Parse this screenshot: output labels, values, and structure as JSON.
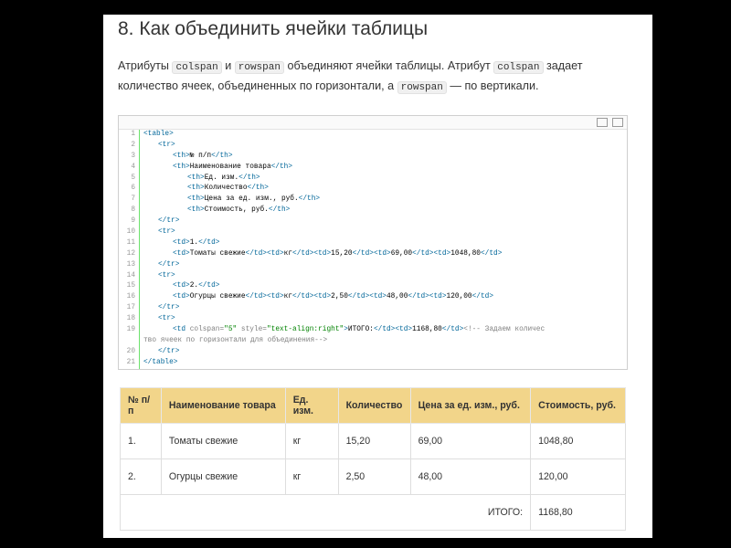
{
  "heading": "8. Как объединить ячейки таблицы",
  "intro": {
    "t1": "Атрибуты ",
    "c1": "colspan",
    "t2": " и ",
    "c2": "rowspan",
    "t3": " объединяют ячейки таблицы. Атрибут ",
    "c3": "colspan",
    "t4": " задает количество ячеек, объединенных по горизонтали, а ",
    "c4": "rowspan",
    "t5": " — по вертикали."
  },
  "code": {
    "toolbar_icons": [
      "copy-icon",
      "expand-icon"
    ],
    "lines": [
      {
        "n": "1",
        "i": 0,
        "parts": [
          [
            "tag",
            "<table>"
          ]
        ]
      },
      {
        "n": "2",
        "i": 1,
        "parts": [
          [
            "tag",
            "<tr>"
          ]
        ]
      },
      {
        "n": "3",
        "i": 2,
        "parts": [
          [
            "tag",
            "<th>"
          ],
          [
            "txt",
            "№ п/п"
          ],
          [
            "tag",
            "</th>"
          ]
        ]
      },
      {
        "n": "4",
        "i": 2,
        "parts": [
          [
            "tag",
            "<th>"
          ],
          [
            "txt",
            "Наименование товара"
          ],
          [
            "tag",
            "</th>"
          ]
        ]
      },
      {
        "n": "5",
        "i": 3,
        "parts": [
          [
            "tag",
            "<th>"
          ],
          [
            "txt",
            "Ед. изм."
          ],
          [
            "tag",
            "</th>"
          ]
        ]
      },
      {
        "n": "6",
        "i": 3,
        "parts": [
          [
            "tag",
            "<th>"
          ],
          [
            "txt",
            "Количество"
          ],
          [
            "tag",
            "</th>"
          ]
        ]
      },
      {
        "n": "7",
        "i": 3,
        "parts": [
          [
            "tag",
            "<th>"
          ],
          [
            "txt",
            "Цена за ед. изм., руб."
          ],
          [
            "tag",
            "</th>"
          ]
        ]
      },
      {
        "n": "8",
        "i": 3,
        "parts": [
          [
            "tag",
            "<th>"
          ],
          [
            "txt",
            "Стоимость, руб."
          ],
          [
            "tag",
            "</th>"
          ]
        ]
      },
      {
        "n": "9",
        "i": 1,
        "parts": [
          [
            "tag",
            "</tr>"
          ]
        ]
      },
      {
        "n": "10",
        "i": 1,
        "parts": [
          [
            "tag",
            "<tr>"
          ]
        ]
      },
      {
        "n": "11",
        "i": 2,
        "parts": [
          [
            "tag",
            "<td>"
          ],
          [
            "txt",
            "1."
          ],
          [
            "tag",
            "</td>"
          ]
        ]
      },
      {
        "n": "12",
        "i": 2,
        "parts": [
          [
            "tag",
            "<td>"
          ],
          [
            "txt",
            "Томаты свежие"
          ],
          [
            "tag",
            "</td><td>"
          ],
          [
            "txt",
            "кг"
          ],
          [
            "tag",
            "</td><td>"
          ],
          [
            "txt",
            "15,20"
          ],
          [
            "tag",
            "</td><td>"
          ],
          [
            "txt",
            "69,00"
          ],
          [
            "tag",
            "</td><td>"
          ],
          [
            "txt",
            "1048,80"
          ],
          [
            "tag",
            "</td>"
          ]
        ]
      },
      {
        "n": "13",
        "i": 1,
        "parts": [
          [
            "tag",
            "</tr>"
          ]
        ]
      },
      {
        "n": "14",
        "i": 1,
        "parts": [
          [
            "tag",
            "<tr>"
          ]
        ]
      },
      {
        "n": "15",
        "i": 2,
        "parts": [
          [
            "tag",
            "<td>"
          ],
          [
            "txt",
            "2."
          ],
          [
            "tag",
            "</td>"
          ]
        ]
      },
      {
        "n": "16",
        "i": 2,
        "parts": [
          [
            "tag",
            "<td>"
          ],
          [
            "txt",
            "Огурцы свежие"
          ],
          [
            "tag",
            "</td><td>"
          ],
          [
            "txt",
            "кг"
          ],
          [
            "tag",
            "</td><td>"
          ],
          [
            "txt",
            "2,50"
          ],
          [
            "tag",
            "</td><td>"
          ],
          [
            "txt",
            "48,00"
          ],
          [
            "tag",
            "</td><td>"
          ],
          [
            "txt",
            "120,00"
          ],
          [
            "tag",
            "</td>"
          ]
        ]
      },
      {
        "n": "17",
        "i": 1,
        "parts": [
          [
            "tag",
            "</tr>"
          ]
        ]
      },
      {
        "n": "18",
        "i": 1,
        "parts": [
          [
            "tag",
            "<tr>"
          ]
        ]
      },
      {
        "n": "19",
        "i": 2,
        "parts": [
          [
            "tag",
            "<td "
          ],
          [
            "attr",
            "colspan="
          ],
          [
            "str",
            "\"5\""
          ],
          [
            "txt",
            " "
          ],
          [
            "attr",
            "style="
          ],
          [
            "str",
            "\"text-align:right\""
          ],
          [
            "tag",
            ">"
          ],
          [
            "txt",
            "ИТОГО:"
          ],
          [
            "tag",
            "</td><td>"
          ],
          [
            "txt",
            "1168,80"
          ],
          [
            "tag",
            "</td>"
          ],
          [
            "cm",
            "<!-- Задаем количес"
          ]
        ]
      },
      {
        "n": "",
        "i": 0,
        "parts": [
          [
            "cm",
            "тво ячеек по горизонтали для объединения-->"
          ]
        ]
      },
      {
        "n": "20",
        "i": 1,
        "parts": [
          [
            "tag",
            "</tr>"
          ]
        ]
      },
      {
        "n": "21",
        "i": 0,
        "parts": [
          [
            "tag",
            "</table>"
          ]
        ]
      }
    ]
  },
  "table": {
    "headers": [
      "№ п/п",
      "Наименование товара",
      "Ед. изм.",
      "Количество",
      "Цена за ед. изм., руб.",
      "Стоимость, руб."
    ],
    "rows": [
      [
        "1.",
        "Томаты свежие",
        "кг",
        "15,20",
        "69,00",
        "1048,80"
      ],
      [
        "2.",
        "Огурцы свежие",
        "кг",
        "2,50",
        "48,00",
        "120,00"
      ]
    ],
    "total_label": "ИТОГО:",
    "total_value": "1168,80"
  }
}
